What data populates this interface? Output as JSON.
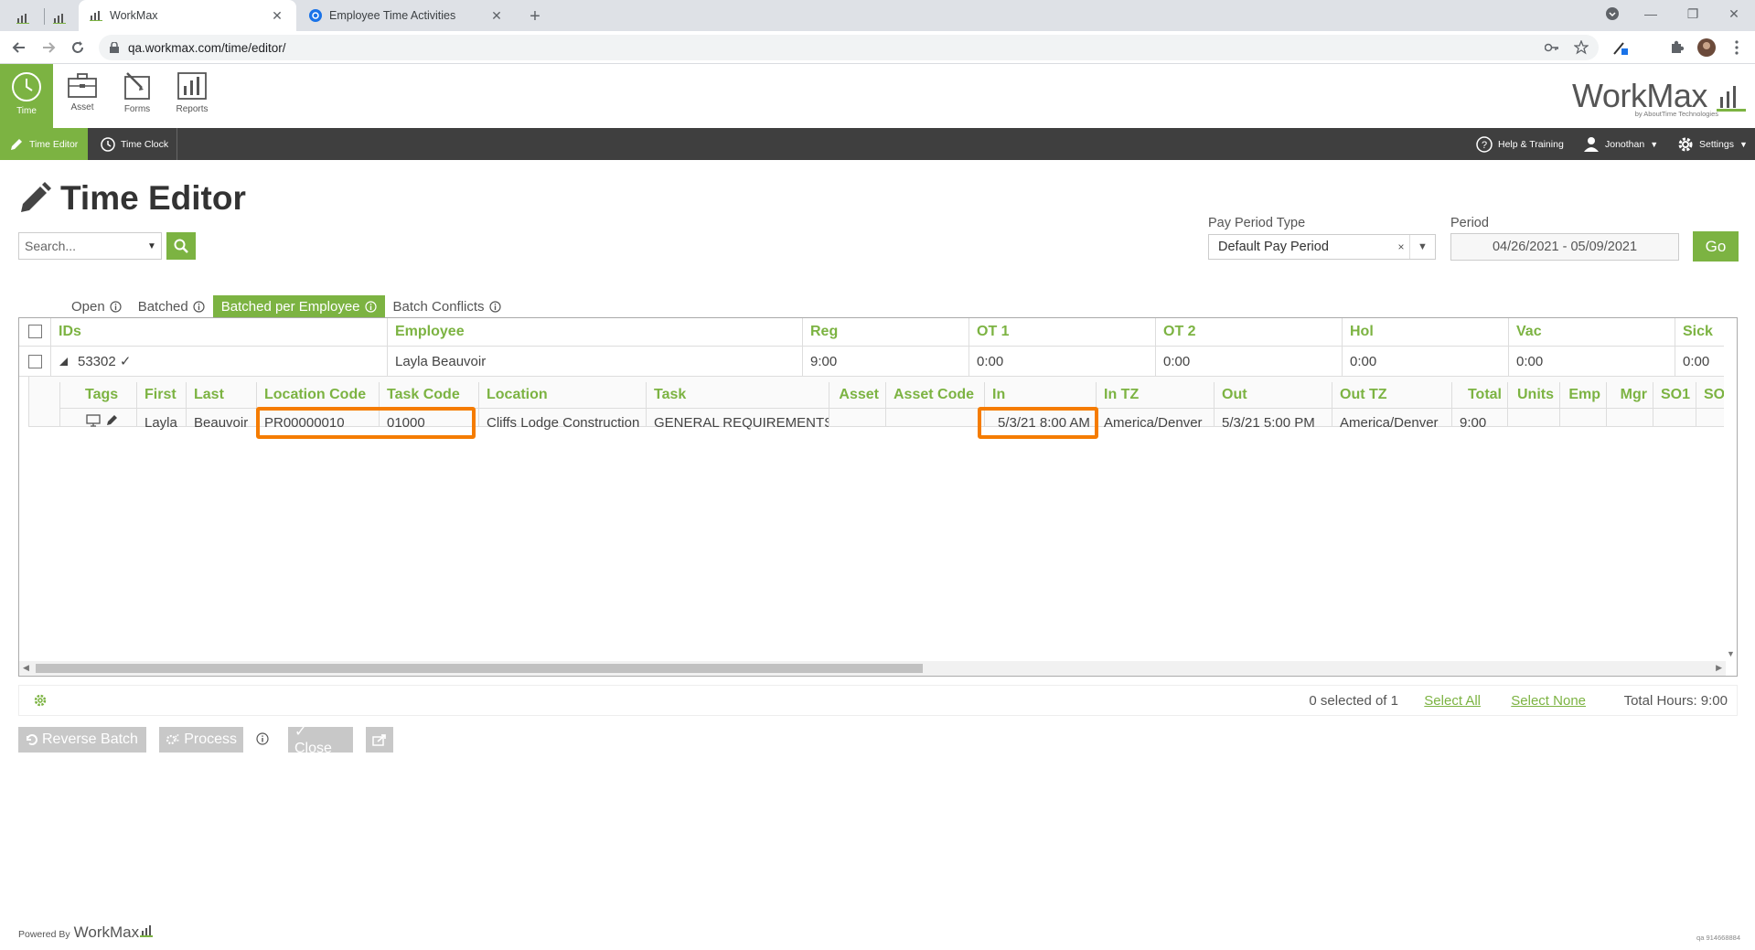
{
  "browser": {
    "tabs": [
      {
        "title": "WorkMax",
        "close": "✕"
      },
      {
        "title": "Employee Time Activities",
        "close": "✕"
      }
    ],
    "new_tab": "+",
    "url": "qa.workmax.com/time/editor/",
    "window_controls": {
      "minimize": "—",
      "restore": "❐",
      "close": "✕"
    }
  },
  "app": {
    "modules": [
      {
        "label": "Time",
        "icon": "clock-icon"
      },
      {
        "label": "Asset",
        "icon": "briefcase-icon"
      },
      {
        "label": "Forms",
        "icon": "form-icon"
      },
      {
        "label": "Reports",
        "icon": "chart-icon"
      }
    ],
    "brand": {
      "name": "WorkMax",
      "tagline": "by AboutTime Technologies"
    },
    "nav": {
      "time_editor": "Time Editor",
      "time_clock": "Time Clock",
      "help": "Help & Training",
      "user": "Jonothan",
      "settings": "Settings"
    }
  },
  "page": {
    "title": "Time Editor",
    "search_placeholder": "Search...",
    "pay_period_type_label": "Pay Period Type",
    "pay_period_type_value": "Default Pay Period",
    "period_label": "Period",
    "period_value": "04/26/2021 - 05/09/2021",
    "go_label": "Go"
  },
  "status_tabs": [
    {
      "label": "Open",
      "active": false
    },
    {
      "label": "Batched",
      "active": false
    },
    {
      "label": "Batched per Employee",
      "active": true
    },
    {
      "label": "Batch Conflicts",
      "active": false
    }
  ],
  "grid": {
    "headers": [
      "IDs",
      "Employee",
      "Reg",
      "OT 1",
      "OT 2",
      "Hol",
      "Vac",
      "Sick"
    ],
    "row": {
      "id": "53302 ✓",
      "employee": "Layla Beauvoir",
      "reg": "9:00",
      "ot1": "0:00",
      "ot2": "0:00",
      "hol": "0:00",
      "vac": "0:00",
      "sick": "0:00"
    },
    "sub_headers": [
      "Tags",
      "First",
      "Last",
      "Location Code",
      "Task Code",
      "Location",
      "Task",
      "Asset",
      "Asset Code",
      "In",
      "In TZ",
      "Out",
      "Out TZ",
      "Total",
      "Units",
      "Emp",
      "Mgr",
      "SO1",
      "SO"
    ],
    "sub_row": {
      "first": "Layla",
      "last": "Beauvoir",
      "location_code": "PR00000010",
      "task_code": "01000",
      "location": "Cliffs Lodge Construction",
      "task": "GENERAL REQUIREMENTS",
      "asset": "",
      "asset_code": "",
      "in": "5/3/21 8:00 AM",
      "in_tz": "America/Denver",
      "out": "5/3/21 5:00 PM",
      "out_tz": "America/Denver",
      "total": "9:00",
      "units": "",
      "emp": "",
      "mgr": "",
      "so1": "",
      "so": ""
    }
  },
  "footer": {
    "selected": "0 selected of 1",
    "select_all": "Select All",
    "select_none": "Select None",
    "total_hours": "Total Hours: 9:00"
  },
  "actions": {
    "reverse_batch": "Reverse Batch",
    "process": "Process",
    "close": "✓ Close"
  },
  "powered_by": {
    "label": "Powered By",
    "brand": "WorkMax"
  },
  "version": "qa 914668884",
  "colors": {
    "accent": "#7cb342",
    "nav_dark": "#3f3f3f",
    "highlight": "#f57c00"
  }
}
